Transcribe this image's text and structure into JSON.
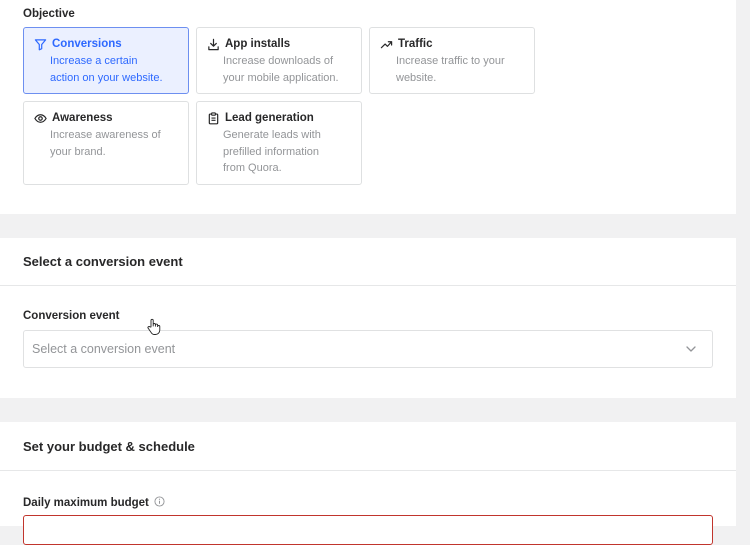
{
  "objective": {
    "label": "Objective",
    "cards": [
      {
        "icon": "funnel-icon",
        "title": "Conversions",
        "desc_lines": [
          "Increase a certain",
          "action on your website."
        ],
        "selected": true
      },
      {
        "icon": "download-icon",
        "title": "App installs",
        "desc_lines": [
          "Increase downloads of",
          "your mobile application."
        ],
        "selected": false
      },
      {
        "icon": "trending-up-icon",
        "title": "Traffic",
        "desc_lines": [
          "Increase traffic to your",
          "website."
        ],
        "selected": false
      },
      {
        "icon": "eye-icon",
        "title": "Awareness",
        "desc_lines": [
          "Increase awareness of",
          "your brand."
        ],
        "selected": false
      },
      {
        "icon": "clipboard-icon",
        "title": "Lead generation",
        "desc_lines": [
          "Generate leads with",
          "prefilled information",
          "from Quora."
        ],
        "selected": false
      }
    ]
  },
  "conversion": {
    "section_title": "Select a conversion event",
    "field_label": "Conversion event",
    "select_placeholder": "Select a conversion event"
  },
  "budget": {
    "section_title": "Set your budget & schedule",
    "field_label": "Daily maximum budget",
    "input_value": ""
  },
  "colors": {
    "accent": "#2e69ff",
    "selected_bg": "#ebf0ff",
    "error_border": "#c1352d"
  }
}
